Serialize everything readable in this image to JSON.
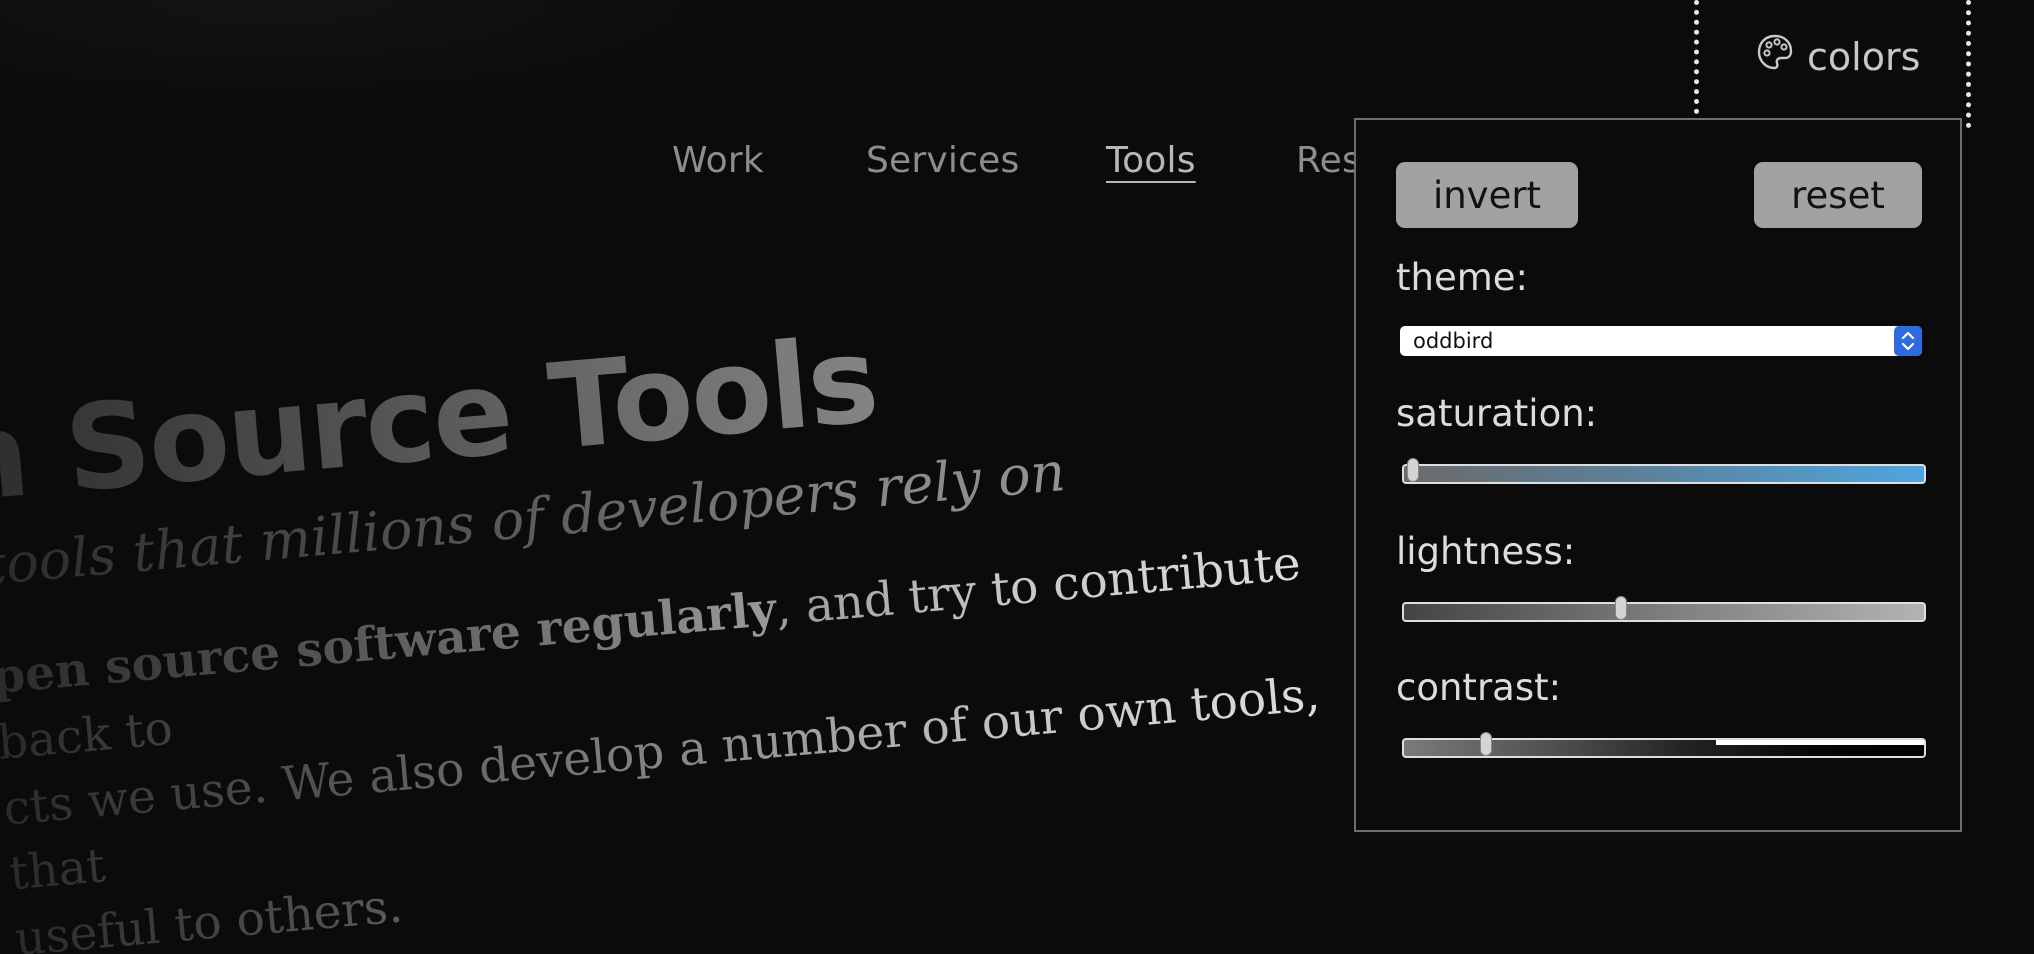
{
  "nav": {
    "items": [
      {
        "label": "Work"
      },
      {
        "label": "Services"
      },
      {
        "label": "Tools",
        "active": true
      },
      {
        "label": "Res"
      }
    ]
  },
  "colors_toggle": {
    "label": "colors",
    "icon": "palette-icon"
  },
  "hero": {
    "title": "n Source Tools",
    "subtitle": "tools that millions of developers rely on",
    "body_bold": "pen source software regularly",
    "body_rest": ", and try to contribute back to",
    "body_line2": "cts we use. We also develop a number of our own tools, that",
    "body_line3": "useful to others."
  },
  "panel": {
    "invert_label": "invert",
    "reset_label": "reset",
    "theme_label": "theme:",
    "theme_value": "oddbird",
    "saturation_label": "saturation:",
    "saturation_value": 0.01,
    "lightness_label": "lightness:",
    "lightness_value": 0.41,
    "contrast_label": "contrast:",
    "contrast_value": 0.15,
    "accent_color": "#2f6be0"
  }
}
